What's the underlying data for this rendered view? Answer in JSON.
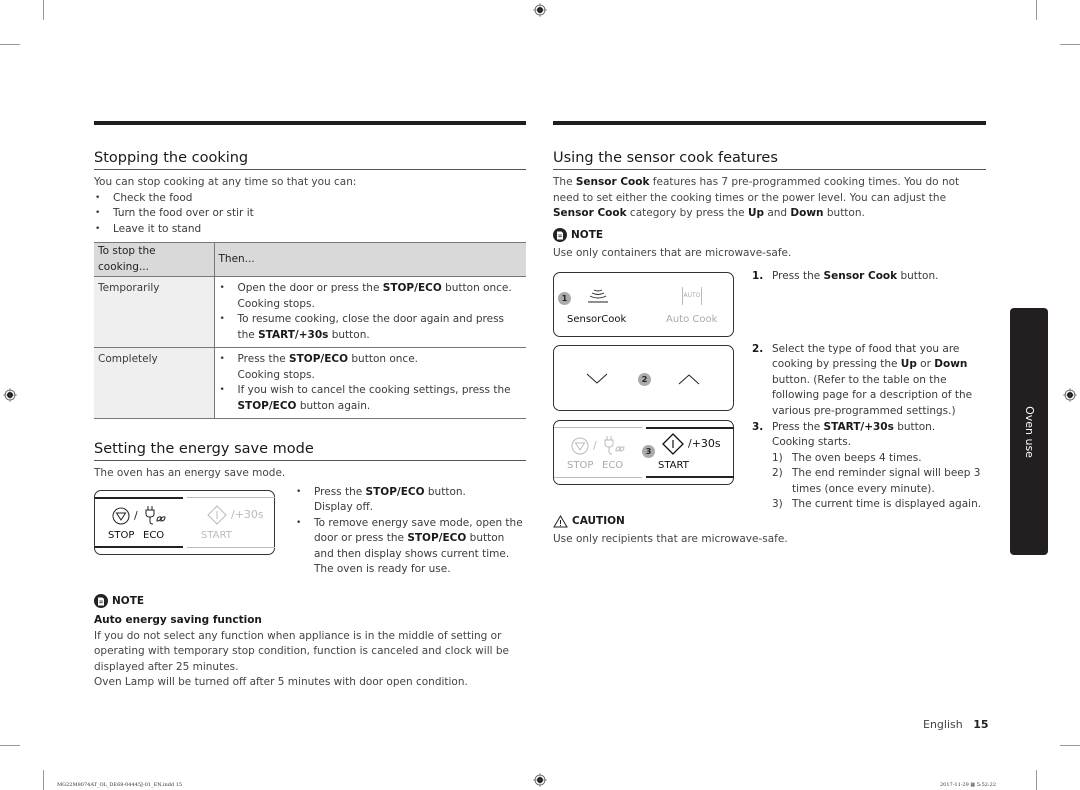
{
  "left": {
    "stopping": {
      "title": "Stopping the cooking",
      "intro": "You can stop cooking at any time so that you can:",
      "bullets": [
        "Check the food",
        "Turn the food over or stir it",
        "Leave it to stand"
      ],
      "table": {
        "headers": [
          "To stop the cooking...",
          "Then..."
        ],
        "rows": [
          {
            "label": "Temporarily",
            "items": [
              {
                "pre": "Open the door or press the ",
                "bold": "STOP/ECO",
                "post": " button once.",
                "line2": "Cooking stops."
              },
              {
                "pre": "To resume cooking, close the door again and press the ",
                "bold": "START/+30s",
                "post": " button.",
                "line2": ""
              }
            ]
          },
          {
            "label": "Completely",
            "items": [
              {
                "pre": "Press the ",
                "bold": "STOP/ECO",
                "post": " button once.",
                "line2": "Cooking stops."
              },
              {
                "pre": "If you wish to cancel the cooking settings, press the ",
                "bold": "STOP/ECO",
                "post": " button again.",
                "line2": ""
              }
            ]
          }
        ]
      }
    },
    "energy": {
      "title": "Setting the energy save mode",
      "intro": "The oven has an energy save mode.",
      "panel": {
        "stop_label": "STOP",
        "eco_label": "ECO",
        "start_label": "START",
        "plus30": "/+30s",
        "slash": "/"
      },
      "bullets": [
        {
          "pre": "Press the ",
          "bold": "STOP/ECO",
          "post": " button.",
          "line2": "Display off."
        },
        {
          "pre": "To remove energy save mode, open the door or press the ",
          "bold": "STOP/ECO",
          "post": " button and then display shows current time. The oven is ready for use.",
          "line2": ""
        }
      ]
    },
    "note": {
      "label": "NOTE",
      "subtitle": "Auto energy saving function",
      "para1": "If you do not select any function when appliance is in the middle of setting or operating with temporary stop condition, function is canceled and clock will be displayed after 25 minutes.",
      "para2": "Oven Lamp will be turned off after 5 minutes with door open condition."
    }
  },
  "right": {
    "title": "Using the sensor cook features",
    "intro": {
      "t1": "The ",
      "b1": "Sensor Cook",
      "t2": " features has 7 pre-programmed cooking times. You do not need to set either the cooking times or the power level. You can adjust the ",
      "b2": "Sensor Cook",
      "t3": " category by press the ",
      "b3": "Up",
      "t4": " and ",
      "b4": "Down",
      "t5": " button."
    },
    "note": {
      "label": "NOTE",
      "text": "Use only containers that are microwave-safe."
    },
    "panel1": {
      "badge": "1",
      "sensor_label": "SensorCook",
      "auto_icon_text": "AUTO",
      "auto_label": "Auto Cook"
    },
    "panel2": {
      "badge": "2"
    },
    "panel3": {
      "badge": "3",
      "stop_label": "STOP",
      "eco_label": "ECO",
      "start_label": "START",
      "plus30": "/+30s",
      "slash": "/"
    },
    "steps": [
      {
        "num": "1.",
        "pre": "Press the ",
        "bold": "Sensor Cook",
        "post": " button."
      },
      {
        "num": "2.",
        "pre": "Select the type of food that you are cooking by pressing the ",
        "bold": "Up",
        "mid": " or ",
        "bold2": "Down",
        "post": " button. (Refer to the table on the following page for a description of the various pre-programmed settings.)"
      },
      {
        "num": "3.",
        "pre": "Press the ",
        "bold": "START/+30s",
        "post": " button.",
        "line2": "Cooking starts."
      }
    ],
    "substeps": [
      {
        "n": "1)",
        "text": "The oven beeps 4 times."
      },
      {
        "n": "2)",
        "text": "The end reminder signal will beep 3 times (once every minute)."
      },
      {
        "n": "3)",
        "text": "The current time is displayed again."
      }
    ],
    "caution": {
      "label": "CAUTION",
      "text": "Use only recipients that are microwave-safe."
    }
  },
  "side_tab": "Oven use",
  "footer": {
    "language": "English",
    "page": "15"
  },
  "slug": {
    "file": "MG22M8074AT_OL_DE68-04445J-01_EN.indd   15",
    "date": "2017-11-29",
    "time": "5:52:22"
  }
}
